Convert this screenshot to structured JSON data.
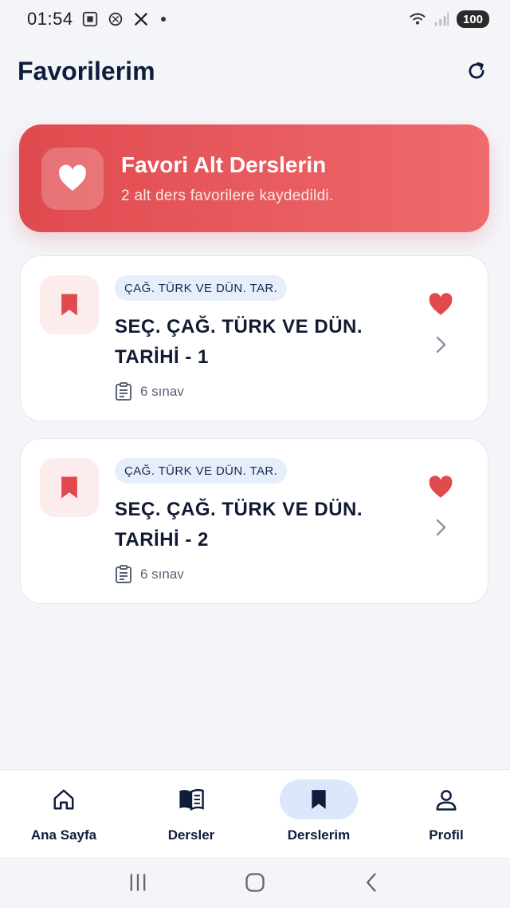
{
  "status_bar": {
    "time": "01:54",
    "battery": "100"
  },
  "header": {
    "title": "Favorilerim"
  },
  "banner": {
    "title": "Favori Alt Derslerin",
    "subtitle": "2 alt ders favorilere kaydedildi."
  },
  "cards": [
    {
      "category": "ÇAĞ. TÜRK VE DÜN. TAR.",
      "title": "SEÇ. ÇAĞ. TÜRK VE DÜN. TARİHİ - 1",
      "meta": "6 sınav"
    },
    {
      "category": "ÇAĞ. TÜRK VE DÜN. TAR.",
      "title": "SEÇ. ÇAĞ. TÜRK VE DÜN. TARİHİ - 2",
      "meta": "6 sınav"
    }
  ],
  "bottom_nav": {
    "items": [
      {
        "label": "Ana Sayfa",
        "icon": "home-icon"
      },
      {
        "label": "Dersler",
        "icon": "book-icon"
      },
      {
        "label": "Derslerim",
        "icon": "bookmark-icon",
        "active": true
      },
      {
        "label": "Profil",
        "icon": "person-icon"
      }
    ]
  },
  "colors": {
    "accent_red": "#e04a4f",
    "navy": "#0f1d3d",
    "active_pill": "#dde7fb"
  }
}
